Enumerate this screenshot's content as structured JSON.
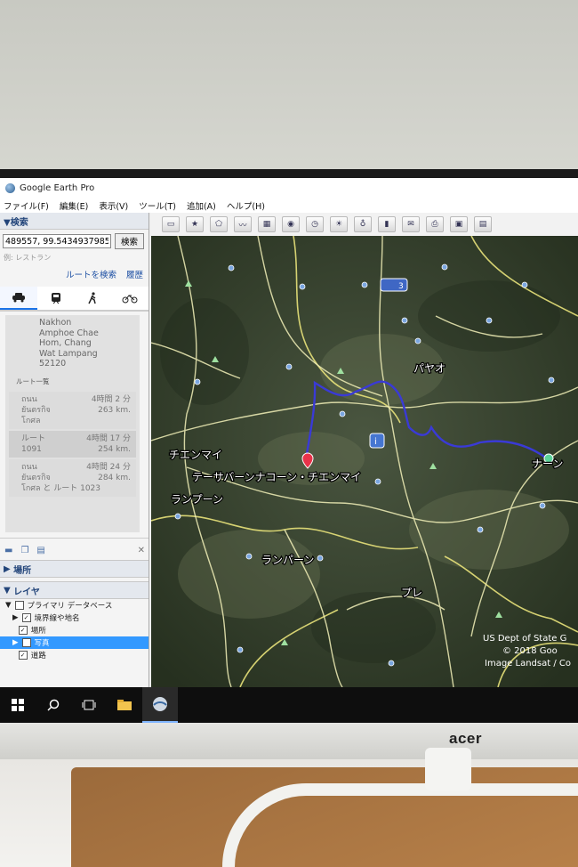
{
  "window": {
    "title": "Google Earth Pro"
  },
  "menu": [
    "ファイル(F)",
    "編集(E)",
    "表示(V)",
    "ツール(T)",
    "追加(A)",
    "ヘルプ(H)"
  ],
  "search": {
    "header": "▼検索",
    "value": "489557, 99.5434937985",
    "button": "検索",
    "example": "例: レストラン",
    "link_route": "ルートを検索",
    "link_history": "履歴"
  },
  "route": {
    "address_lines": [
      "Nakhon",
      "Amphoe Chae",
      "Hom, Chang",
      "Wat Lampang",
      "52120"
    ],
    "list_header": "ルート一覧",
    "items": [
      {
        "name": "ถนน",
        "time": "4時間 2 分",
        "via": "ยันตรกิจ",
        "dist": "263 km.",
        "via2": "โกศล"
      },
      {
        "name": "ルート",
        "time": "4時間 17 分",
        "via": "1091",
        "dist": "254 km.",
        "via2": ""
      },
      {
        "name": "ถนน",
        "time": "4時間 24 分",
        "via": "ยันตรกิจ",
        "dist": "284 km.",
        "via2": "โกศล と ルート 1023"
      }
    ]
  },
  "places": {
    "header": "場所"
  },
  "layers": {
    "header": "レイヤ",
    "items": [
      "プライマリ データベース",
      "境界線や地名",
      "場所",
      "写真",
      "道路"
    ]
  },
  "map": {
    "labels": {
      "payao": "パヤオ",
      "chiangmai": "チエンマイ",
      "destination": "テーサバーンナコーン・チエンマイ",
      "lamphun": "ランプーン",
      "lampang": "ランパーン",
      "nan": "ナーン",
      "phrae": "プレ",
      "highway": "3"
    },
    "attribution": [
      "US Dept of State G",
      "© 2018 Goo",
      "Image Landsat / Co"
    ],
    "route_color": "#3a3ad6",
    "road_color": "#f2f0b8",
    "pin_color": "#e8334a"
  },
  "monitor": {
    "brand": "acer"
  }
}
